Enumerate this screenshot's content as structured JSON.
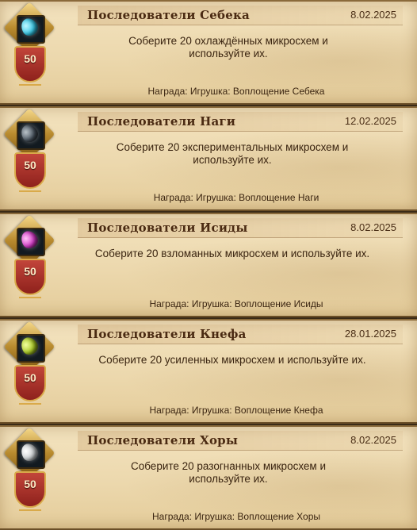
{
  "achievements": [
    {
      "title": "Последователи Себека",
      "date": "8.02.2025",
      "description": "Соберите 20 охлаждённых микросхем и используйте их.",
      "reward": "Награда: Игрушка: Воплощение Себека",
      "level": "50",
      "gem_color": "#38c7e6",
      "gem_glow": "#bff6ff",
      "icon": "cyan-gem-icon"
    },
    {
      "title": "Последователи Наги",
      "date": "12.02.2025",
      "description": "Соберите 20 экспериментальных микросхем и используйте их.",
      "reward": "Награда: Игрушка: Воплощение Наги",
      "level": "50",
      "gem_color": "#4a5560",
      "gem_glow": "#b9c2c8",
      "icon": "dark-gem-icon"
    },
    {
      "title": "Последователи Исиды",
      "date": "8.02.2025",
      "description": "Соберите 20 взломанных микросхем и используйте их.",
      "reward": "Награда: Игрушка: Воплощение Исиды",
      "level": "50",
      "gem_color": "#d23ac6",
      "gem_glow": "#ffc4f6",
      "icon": "magenta-gem-icon"
    },
    {
      "title": "Последователи Кнефа",
      "date": "28.01.2025",
      "description": "Соберите 20 усиленных микросхем и используйте их.",
      "reward": "Награда: Игрушка: Воплощение Кнефа",
      "level": "50",
      "gem_color": "#a7c623",
      "gem_glow": "#f0ff9e",
      "icon": "green-gem-icon"
    },
    {
      "title": "Последователи Хоры",
      "date": "8.02.2025",
      "description": "Соберите 20 разогнанных микросхем и используйте их.",
      "reward": "Награда: Игрушка: Воплощение Хоры",
      "level": "50",
      "gem_color": "#c9ced0",
      "gem_glow": "#ffffff",
      "icon": "silver-gem-icon"
    }
  ]
}
